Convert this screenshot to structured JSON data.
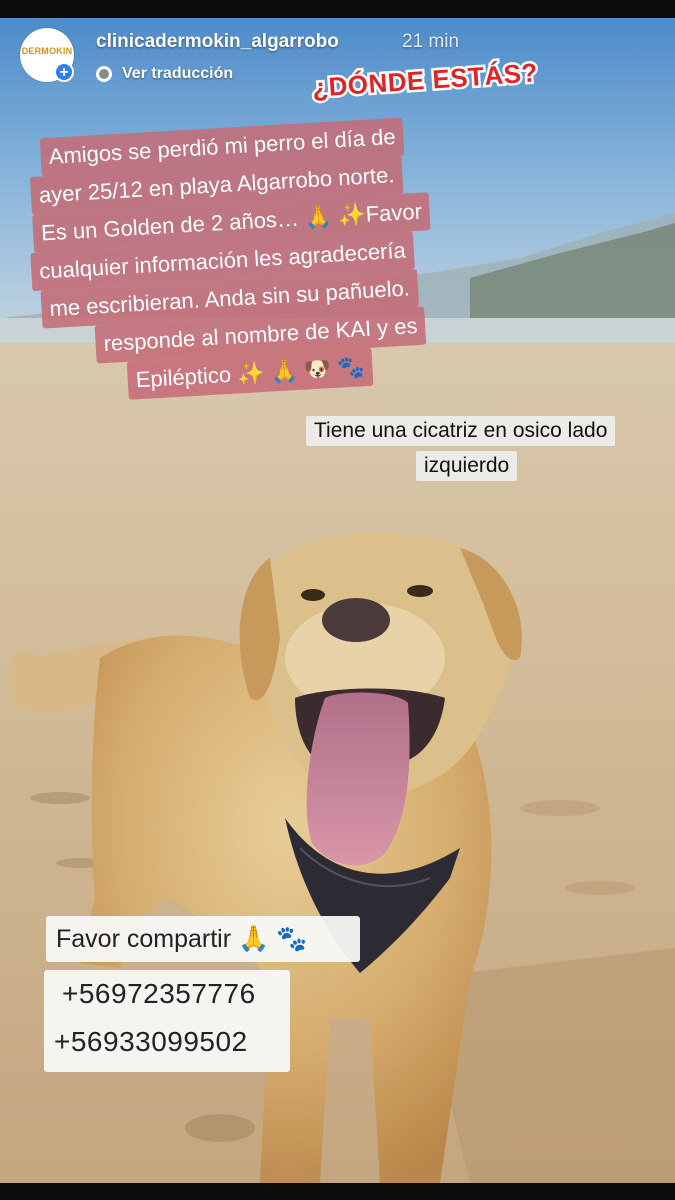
{
  "story": {
    "username": "clinicadermokin_algarrobo",
    "time_ago": "21 min",
    "translate_label": "Ver traducción",
    "avatar_text": "DERMOKIN",
    "avatar_badge": "+"
  },
  "sticker": {
    "text": "¿DÓNDE ESTÁS?"
  },
  "message": {
    "lines": [
      "Amigos  se perdió mi perro el día de",
      "ayer  25/12 en playa Algarrobo norte.",
      "Es un Golden de 2 años… 🙏 ✨Favor",
      "cualquier información les agradecería",
      "me escribieran.  Anda sin su pañuelo.",
      "responde al nombre de KAI y es",
      "Epiléptico  ✨ 🙏 🐶 🐾"
    ]
  },
  "scar_note": {
    "line1": "Tiene una cicatriz en osico lado",
    "line2": "izquierdo"
  },
  "contact": {
    "favor": "Favor compartir 🙏 🐾",
    "phone1": "+56972357776",
    "phone2": "+56933099502"
  },
  "colors": {
    "sticker_red": "#e02424",
    "message_background": "#c46c76",
    "verified_badge": "#2b7ff0"
  }
}
